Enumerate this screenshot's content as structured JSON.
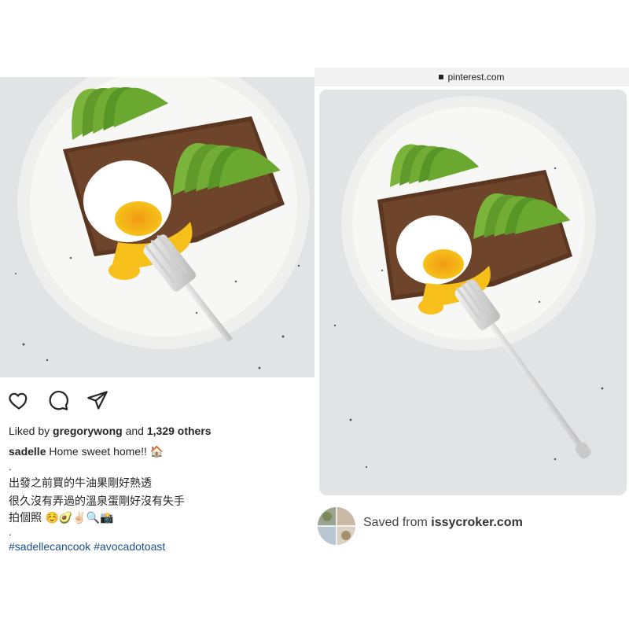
{
  "instagram": {
    "likes": {
      "prefix": "Liked by ",
      "user": "gregorywong",
      "joiner": " and ",
      "count": "1,329 others"
    },
    "caption": {
      "user": "sadelle",
      "text": " Home sweet home!! 🏠"
    },
    "dot1": ".",
    "lines": [
      "出發之前買的牛油果剛好熟透",
      "很久沒有弄過的溫泉蛋剛好沒有失手",
      "拍個照 ☺️🥑✌🏻🔍📸"
    ],
    "dot2": ".",
    "hashtags": [
      "#sadellecancook",
      "#avocadotoast"
    ]
  },
  "pinterest": {
    "url": "pinterest.com",
    "saved_prefix": "Saved from ",
    "saved_source": "issycroker.com"
  }
}
